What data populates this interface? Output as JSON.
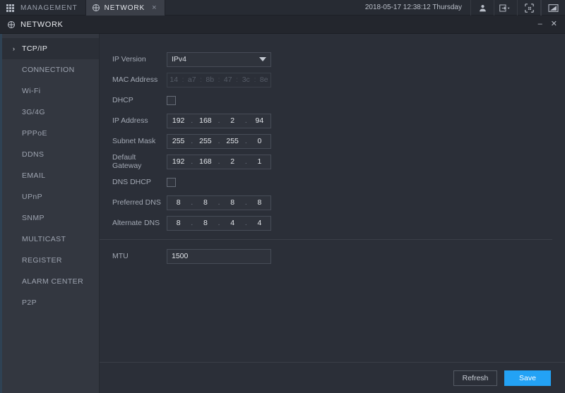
{
  "topbar": {
    "tabs": [
      {
        "label": "MANAGEMENT",
        "icon": "grid-icon",
        "active": false,
        "closable": false
      },
      {
        "label": "NETWORK",
        "icon": "globe-icon",
        "active": true,
        "closable": true,
        "close_glyph": "×"
      }
    ],
    "clock": "2018-05-17 12:38:12 Thursday",
    "icons": [
      "user-icon",
      "logout-icon",
      "qr-grid-icon",
      "screen-icon"
    ]
  },
  "window": {
    "title": "NETWORK",
    "icon": "globe-icon",
    "minimize_glyph": "–",
    "close_glyph": "✕"
  },
  "sidebar": {
    "active_caret": "›",
    "items": [
      {
        "label": "TCP/IP",
        "active": true
      },
      {
        "label": "CONNECTION",
        "active": false
      },
      {
        "label": "Wi-Fi",
        "active": false
      },
      {
        "label": "3G/4G",
        "active": false
      },
      {
        "label": "PPPoE",
        "active": false
      },
      {
        "label": "DDNS",
        "active": false
      },
      {
        "label": "EMAIL",
        "active": false
      },
      {
        "label": "UPnP",
        "active": false
      },
      {
        "label": "SNMP",
        "active": false
      },
      {
        "label": "MULTICAST",
        "active": false
      },
      {
        "label": "REGISTER",
        "active": false
      },
      {
        "label": "ALARM CENTER",
        "active": false
      },
      {
        "label": "P2P",
        "active": false
      }
    ]
  },
  "form": {
    "ip_version": {
      "label": "IP Version",
      "value": "IPv4"
    },
    "mac_address": {
      "label": "MAC Address",
      "octets": [
        "14",
        "a7",
        "8b",
        "47",
        "3c",
        "8e"
      ],
      "separator": ":",
      "disabled": true
    },
    "dhcp": {
      "label": "DHCP",
      "checked": false
    },
    "ip_address": {
      "label": "IP Address",
      "octets": [
        "192",
        "168",
        "2",
        "94"
      ],
      "separator": "."
    },
    "subnet_mask": {
      "label": "Subnet Mask",
      "octets": [
        "255",
        "255",
        "255",
        "0"
      ],
      "separator": "."
    },
    "default_gateway": {
      "label": "Default Gateway",
      "octets": [
        "192",
        "168",
        "2",
        "1"
      ],
      "separator": "."
    },
    "dns_dhcp": {
      "label": "DNS DHCP",
      "checked": false
    },
    "preferred_dns": {
      "label": "Preferred DNS",
      "octets": [
        "8",
        "8",
        "8",
        "8"
      ],
      "separator": "."
    },
    "alternate_dns": {
      "label": "Alternate DNS",
      "octets": [
        "8",
        "8",
        "4",
        "4"
      ],
      "separator": "."
    },
    "mtu": {
      "label": "MTU",
      "value": "1500"
    }
  },
  "footer": {
    "refresh_label": "Refresh",
    "save_label": "Save"
  },
  "colors": {
    "accent": "#23a2f5",
    "panel": "#2b2f38",
    "sidebar": "#333740",
    "topbar": "#272b33"
  }
}
